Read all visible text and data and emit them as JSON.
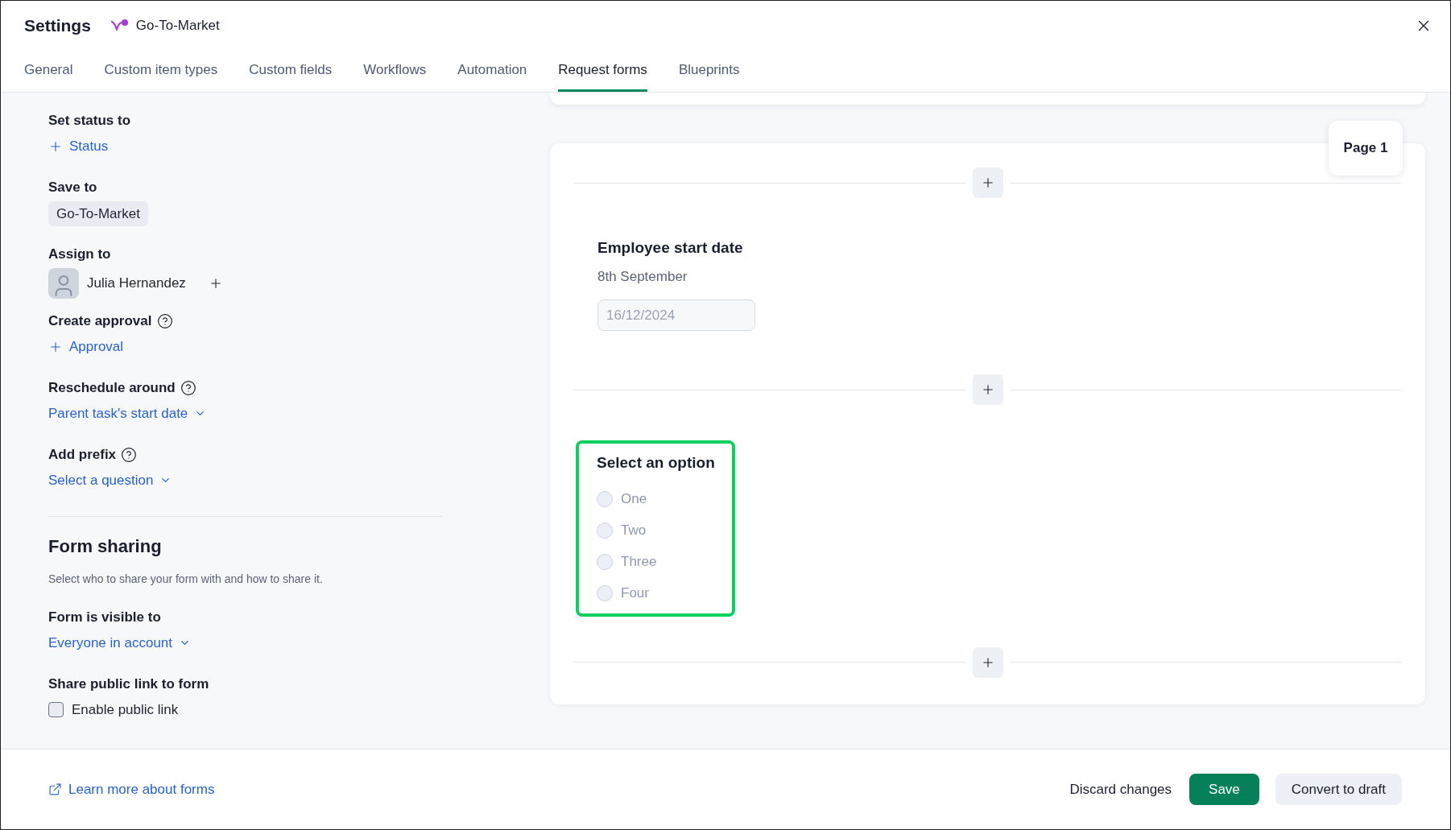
{
  "header": {
    "title": "Settings",
    "workspace": "Go-To-Market"
  },
  "tabs": [
    {
      "label": "General",
      "selected": false
    },
    {
      "label": "Custom item types",
      "selected": false
    },
    {
      "label": "Custom fields",
      "selected": false
    },
    {
      "label": "Workflows",
      "selected": false
    },
    {
      "label": "Automation",
      "selected": false
    },
    {
      "label": "Request forms",
      "selected": true
    },
    {
      "label": "Blueprints",
      "selected": false
    }
  ],
  "settings": [
    {
      "kind": "add",
      "label": "Set status to",
      "help": false,
      "value": "Status"
    },
    {
      "kind": "chip",
      "label": "Save to",
      "help": false,
      "value": "Go-To-Market"
    },
    {
      "kind": "assignee",
      "label": "Assign to",
      "help": false,
      "value": "Julia Hernandez"
    },
    {
      "kind": "add",
      "label": "Create approval",
      "help": true,
      "value": "Approval"
    },
    {
      "kind": "dropdown",
      "label": "Reschedule around",
      "help": true,
      "value": "Parent task's start date"
    },
    {
      "kind": "dropdown",
      "label": "Add prefix",
      "help": true,
      "value": "Select a question"
    }
  ],
  "sharing": {
    "title": "Form sharing",
    "description": "Select who to share your form with and how to share it.",
    "fields": [
      {
        "kind": "dropdown",
        "label": "Form is visible to",
        "value": "Everyone in account"
      },
      {
        "kind": "checkbox",
        "label": "Share public link to form",
        "value": "Enable public link",
        "checked": false
      }
    ]
  },
  "form": {
    "page_label": "Page 1",
    "questions": [
      {
        "kind": "date",
        "title": "Employee start date",
        "description": "8th September",
        "placeholder": "16/12/2024",
        "highlighted": false
      },
      {
        "kind": "radio",
        "title": "Select an option",
        "highlighted": true,
        "options": [
          {
            "label": "One",
            "selected": false
          },
          {
            "label": "Two",
            "selected": false
          },
          {
            "label": "Three",
            "selected": false
          },
          {
            "label": "Four",
            "selected": false
          }
        ]
      }
    ]
  },
  "footer": {
    "link": "Learn more about forms",
    "buttons": [
      {
        "kind": "text",
        "label": "Discard changes"
      },
      {
        "kind": "primary",
        "label": "Save"
      },
      {
        "kind": "secondary",
        "label": "Convert to draft"
      }
    ]
  }
}
